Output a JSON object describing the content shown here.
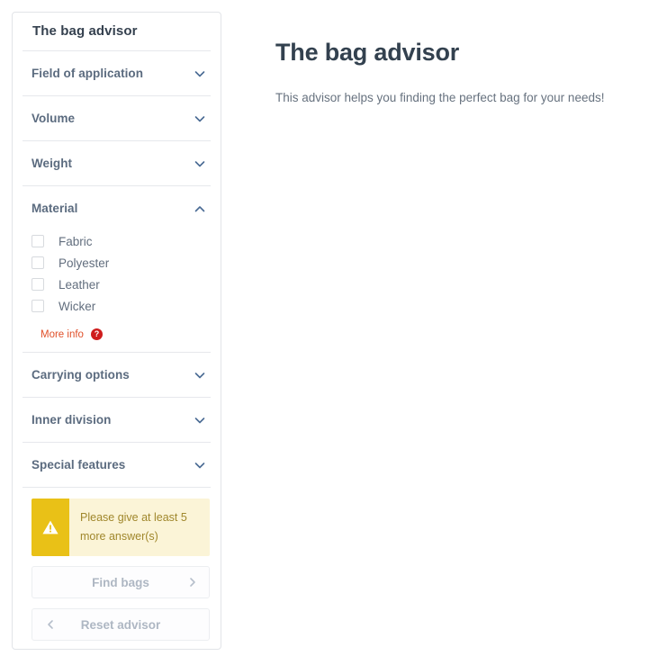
{
  "sidebar": {
    "title": "The bag advisor",
    "sections": [
      {
        "label": "Field of application",
        "icon": "chevron-down-icon",
        "expanded": false
      },
      {
        "label": "Volume",
        "icon": "chevron-down-icon",
        "expanded": false
      },
      {
        "label": "Weight",
        "icon": "chevron-down-icon",
        "expanded": false
      },
      {
        "label": "Material",
        "icon": "chevron-up-icon",
        "expanded": true
      },
      {
        "label": "Carrying options",
        "icon": "chevron-down-icon",
        "expanded": false
      },
      {
        "label": "Inner division",
        "icon": "chevron-down-icon",
        "expanded": false
      },
      {
        "label": "Special features",
        "icon": "chevron-down-icon",
        "expanded": false
      }
    ],
    "material_options": [
      {
        "label": "Fabric",
        "checked": false
      },
      {
        "label": "Polyester",
        "checked": false
      },
      {
        "label": "Leather",
        "checked": false
      },
      {
        "label": "Wicker",
        "checked": false
      }
    ],
    "more_info": {
      "label": "More info",
      "icon": "question-mark-icon"
    },
    "warning": {
      "icon": "warning-triangle-icon",
      "text": "Please give at least 5 more answer(s)"
    },
    "find_button": {
      "label": "Find bags",
      "icon": "chevron-right-icon",
      "disabled": true
    },
    "reset_button": {
      "label": "Reset advisor",
      "icon": "chevron-left-icon",
      "disabled": true
    }
  },
  "main": {
    "title": "The bag advisor",
    "subtitle": "This advisor helps you finding the perfect bag for your needs!"
  },
  "colors": {
    "accent_orange": "#e0502a",
    "help_red": "#cf1d1d",
    "warning_gold": "#e9c117",
    "warning_bg": "#fbf4d7",
    "warning_text": "#a0872c",
    "heading": "#33414f",
    "section_label": "#5b6b7f",
    "panel_border": "#e2e4e8"
  }
}
